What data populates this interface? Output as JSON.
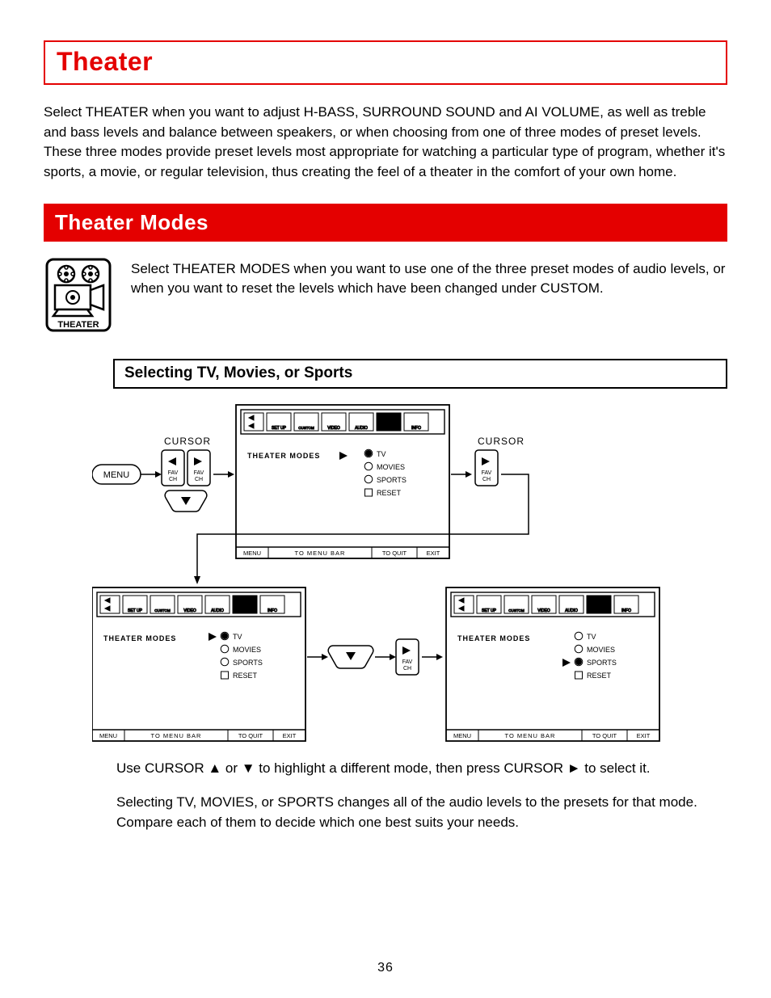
{
  "title": "Theater",
  "intro": "Select THEATER when you want to adjust H-BASS, SURROUND SOUND and AI VOLUME, as well as treble and bass levels and balance between speakers, or when choosing from one of three modes of preset levels. These three modes provide preset levels most appropriate for watching a particular type of program, whether it's sports, a movie, or regular television, thus creating the feel of a theater in the comfort of your own home.",
  "section_heading": "Theater Modes",
  "theater_desc": "Select THEATER MODES when you want to use one of the three preset modes of audio levels, or when you want to reset the levels which have been changed under CUSTOM.",
  "subheading": "Selecting TV, Movies, or Sports",
  "footer_hint": "Use CURSOR ▲ or ▼ to highlight a different mode, then press CURSOR ► to select it.",
  "closing_para": "Selecting TV, MOVIES, or SPORTS changes all of the audio levels to the presets for that mode.  Compare each of them to decide which one best suits your needs.",
  "page_number": "36",
  "theater_icon_label": "THEATER",
  "diagram": {
    "menu_btn": "MENU",
    "cursor_label": "CURSOR",
    "fav_ch": "FAV\nCH",
    "theater_modes_label": "THEATER MODES",
    "options": [
      "TV",
      "MOVIES",
      "SPORTS",
      "RESET"
    ],
    "footer_menu": "MENU",
    "footer_to_menu_bar": "TO MENU BAR",
    "footer_to_quit": "TO QUIT",
    "footer_exit": "EXIT"
  }
}
